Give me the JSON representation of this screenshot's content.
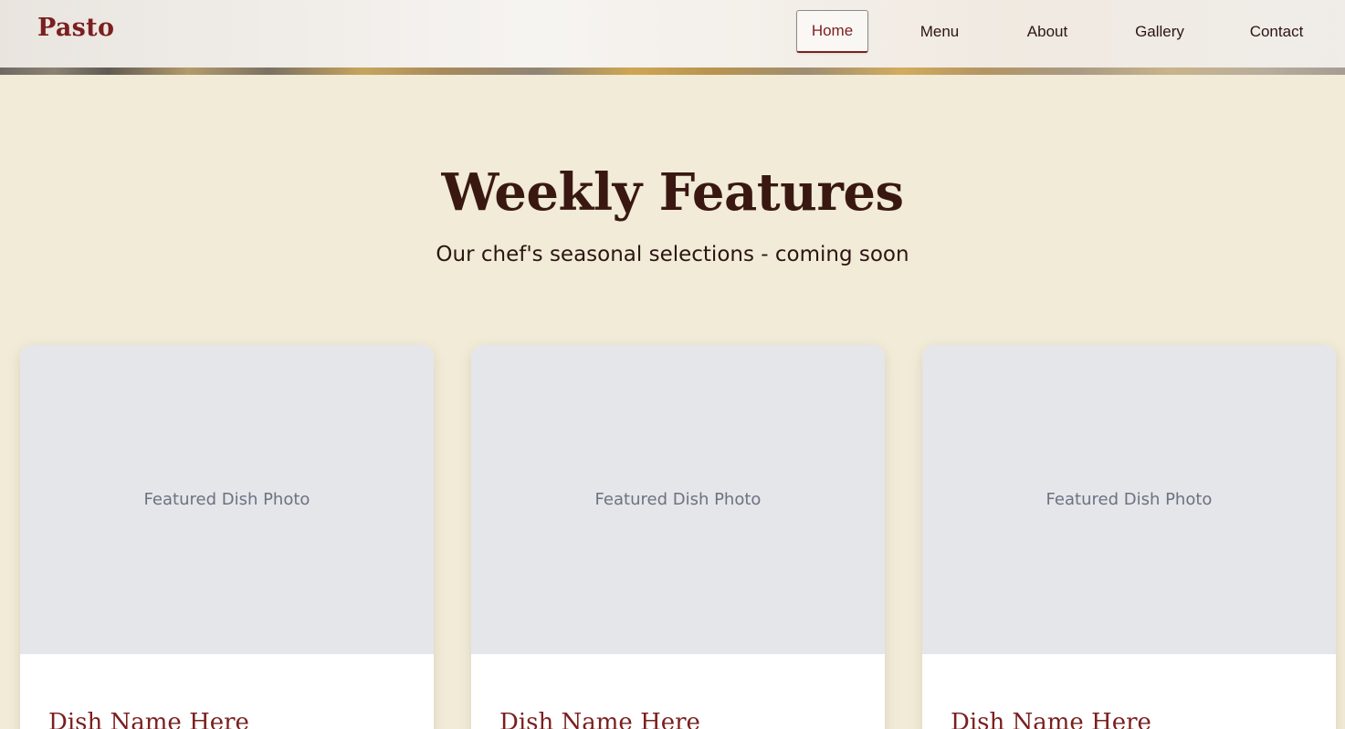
{
  "header": {
    "logo": "Pasto",
    "nav": [
      {
        "label": "Home",
        "active": true
      },
      {
        "label": "Menu",
        "active": false
      },
      {
        "label": "About",
        "active": false
      },
      {
        "label": "Gallery",
        "active": false
      },
      {
        "label": "Contact",
        "active": false
      }
    ]
  },
  "features": {
    "title": "Weekly Features",
    "subtitle": "Our chef's seasonal selections - coming soon",
    "cards": [
      {
        "photo_label": "Featured Dish Photo",
        "dish_name": "Dish Name Here"
      },
      {
        "photo_label": "Featured Dish Photo",
        "dish_name": "Dish Name Here"
      },
      {
        "photo_label": "Featured Dish Photo",
        "dish_name": "Dish Name Here"
      }
    ]
  },
  "colors": {
    "brand": "#7b1f1f",
    "page_background": "#f1ebd8",
    "heading_text": "#3a1812",
    "placeholder_bg": "#e5e6ea",
    "placeholder_text": "#6b7280"
  }
}
